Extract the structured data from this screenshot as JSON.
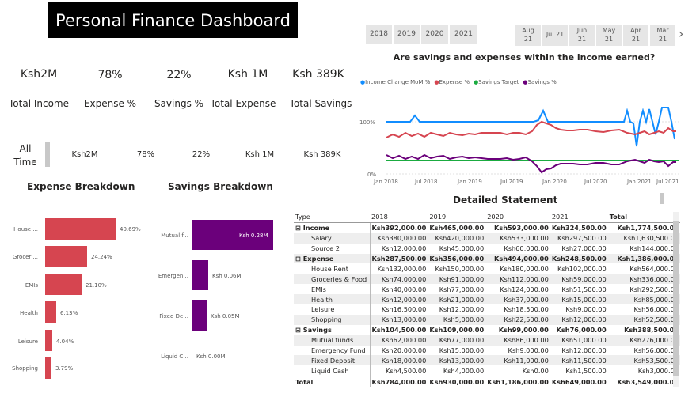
{
  "title": "Personal Finance Dashboard",
  "kpis": [
    {
      "value": "Ksh2M",
      "label": "Total Income"
    },
    {
      "value": "78%",
      "label": "Expense %"
    },
    {
      "value": "22%",
      "label": "Savings %"
    },
    {
      "value": "Ksh 1M",
      "label": "Total Expense"
    },
    {
      "value": "Ksh 389K",
      "label": "Total Savings"
    }
  ],
  "alltime": {
    "label": "All Time",
    "values": [
      "Ksh2M",
      "78%",
      "22%",
      "Ksh 1M",
      "Ksh 389K"
    ]
  },
  "year_slicer": [
    "2018",
    "2019",
    "2020",
    "2021"
  ],
  "month_slicer": [
    {
      "m": "Aug",
      "y": "21"
    },
    {
      "m": "Jul 21",
      "y": ""
    },
    {
      "m": "Jun",
      "y": "21"
    },
    {
      "m": "May",
      "y": "21"
    },
    {
      "m": "Apr",
      "y": "21"
    },
    {
      "m": "Mar",
      "y": "21"
    }
  ],
  "chevron_right": "›",
  "line_chart": {
    "title": "Are savings and expenses within the income earned?",
    "legend": [
      {
        "name": "Income Change MoM %",
        "color": "#118DFF"
      },
      {
        "name": "Expense %",
        "color": "#D64550"
      },
      {
        "name": "Savings Target",
        "color": "#1AAB40"
      },
      {
        "name": "Savings %",
        "color": "#6B007B"
      }
    ],
    "y_ticks": [
      "100%",
      "0%"
    ],
    "x_ticks": [
      "Jan 2018",
      "Jul 2018",
      "Jan 2019",
      "Jul 2019",
      "Jan 2020",
      "Jul 2020",
      "Jan 2021",
      "Jul 2021"
    ]
  },
  "expense_breakdown": {
    "title": "Expense Breakdown",
    "color": "#D64550",
    "items": [
      {
        "label": "House ...",
        "pct": 40.69,
        "text": "40.69%"
      },
      {
        "label": "Groceri...",
        "pct": 24.24,
        "text": "24.24%"
      },
      {
        "label": "EMIs",
        "pct": 21.1,
        "text": "21.10%"
      },
      {
        "label": "Health",
        "pct": 6.13,
        "text": "6.13%"
      },
      {
        "label": "Leisure",
        "pct": 4.04,
        "text": "4.04%"
      },
      {
        "label": "Shopping",
        "pct": 3.79,
        "text": "3.79%"
      }
    ]
  },
  "savings_breakdown": {
    "title": "Savings Breakdown",
    "color": "#6B007B",
    "items": [
      {
        "label": "Mutual f...",
        "value": 0.28,
        "text": "Ksh 0.28M"
      },
      {
        "label": "Emergen...",
        "value": 0.06,
        "text": "Ksh 0.06M"
      },
      {
        "label": "Fixed De...",
        "value": 0.05,
        "text": "Ksh 0.05M"
      },
      {
        "label": "Liquid C...",
        "value": 0.0,
        "text": "Ksh 0.00M"
      }
    ]
  },
  "statement": {
    "title": "Detailed Statement",
    "headers": [
      "Type",
      "2018",
      "2019",
      "2020",
      "2021",
      "Total"
    ],
    "rows": [
      {
        "kind": "grp",
        "cells": [
          "⊟  Income",
          "Ksh392,000.00",
          "Ksh465,000.00",
          "Ksh593,000.00",
          "Ksh324,500.00",
          "Ksh1,774,500.00"
        ]
      },
      {
        "kind": "shade",
        "cells": [
          "Salary",
          "Ksh380,000.00",
          "Ksh420,000.00",
          "Ksh533,000.00",
          "Ksh297,500.00",
          "Ksh1,630,500.00"
        ]
      },
      {
        "kind": "plain",
        "cells": [
          "Source 2",
          "Ksh12,000.00",
          "Ksh45,000.00",
          "Ksh60,000.00",
          "Ksh27,000.00",
          "Ksh144,000.00"
        ]
      },
      {
        "kind": "grp shade",
        "cells": [
          "⊟  Expense",
          "Ksh287,500.00",
          "Ksh356,000.00",
          "Ksh494,000.00",
          "Ksh248,500.00",
          "Ksh1,386,000.00"
        ]
      },
      {
        "kind": "plain",
        "cells": [
          "House Rent",
          "Ksh132,000.00",
          "Ksh150,000.00",
          "Ksh180,000.00",
          "Ksh102,000.00",
          "Ksh564,000.00"
        ]
      },
      {
        "kind": "shade",
        "cells": [
          "Groceries & Food",
          "Ksh74,000.00",
          "Ksh91,000.00",
          "Ksh112,000.00",
          "Ksh59,000.00",
          "Ksh336,000.00"
        ]
      },
      {
        "kind": "plain",
        "cells": [
          "EMIs",
          "Ksh40,000.00",
          "Ksh77,000.00",
          "Ksh124,000.00",
          "Ksh51,500.00",
          "Ksh292,500.00"
        ]
      },
      {
        "kind": "shade",
        "cells": [
          "Health",
          "Ksh12,000.00",
          "Ksh21,000.00",
          "Ksh37,000.00",
          "Ksh15,000.00",
          "Ksh85,000.00"
        ]
      },
      {
        "kind": "plain",
        "cells": [
          "Leisure",
          "Ksh16,500.00",
          "Ksh12,000.00",
          "Ksh18,500.00",
          "Ksh9,000.00",
          "Ksh56,000.00"
        ]
      },
      {
        "kind": "shade",
        "cells": [
          "Shopping",
          "Ksh13,000.00",
          "Ksh5,000.00",
          "Ksh22,500.00",
          "Ksh12,000.00",
          "Ksh52,500.00"
        ]
      },
      {
        "kind": "grp",
        "cells": [
          "⊟  Savings",
          "Ksh104,500.00",
          "Ksh109,000.00",
          "Ksh99,000.00",
          "Ksh76,000.00",
          "Ksh388,500.00"
        ]
      },
      {
        "kind": "shade",
        "cells": [
          "Mutual funds",
          "Ksh62,000.00",
          "Ksh77,000.00",
          "Ksh86,000.00",
          "Ksh51,000.00",
          "Ksh276,000.00"
        ]
      },
      {
        "kind": "plain",
        "cells": [
          "Emergency Fund",
          "Ksh20,000.00",
          "Ksh15,000.00",
          "Ksh9,000.00",
          "Ksh12,000.00",
          "Ksh56,000.00"
        ]
      },
      {
        "kind": "shade",
        "cells": [
          "Fixed Deposit",
          "Ksh18,000.00",
          "Ksh13,000.00",
          "Ksh11,000.00",
          "Ksh11,500.00",
          "Ksh53,500.00"
        ]
      },
      {
        "kind": "plain",
        "cells": [
          "Liquid Cash",
          "Ksh4,500.00",
          "Ksh4,000.00",
          "Ksh0.00",
          "Ksh1,500.00",
          "Ksh3,000.00"
        ]
      }
    ],
    "total": [
      "Total",
      "Ksh784,000.00",
      "Ksh930,000.00",
      "Ksh1,186,000.00",
      "Ksh649,000.00",
      "Ksh3,549,000.00"
    ]
  }
}
